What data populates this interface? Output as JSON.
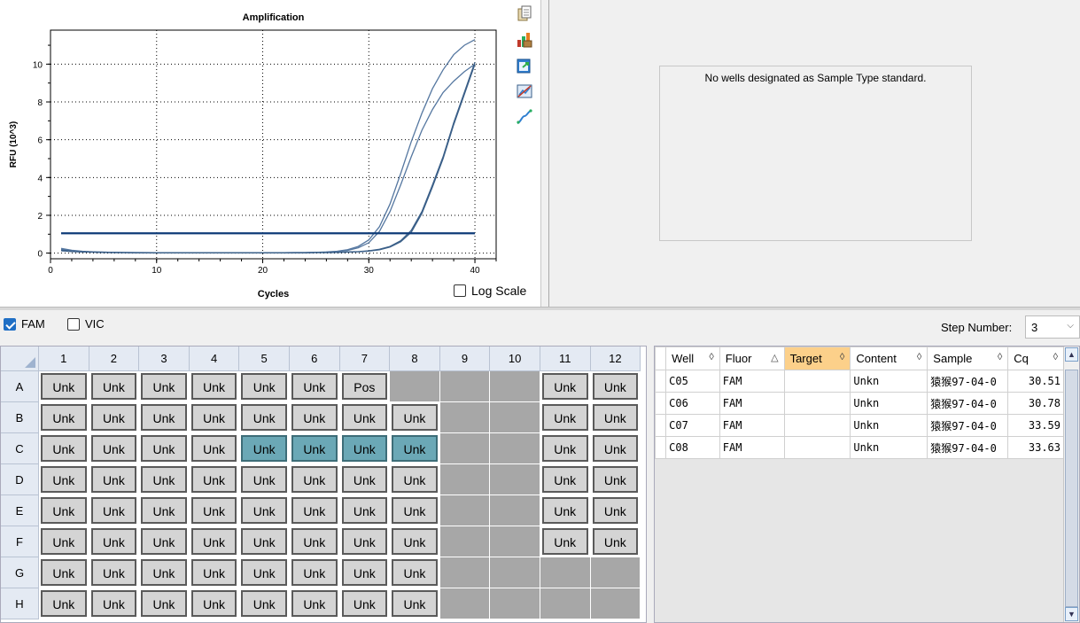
{
  "chart_data": {
    "type": "line",
    "title": "Amplification",
    "xlabel": "Cycles",
    "ylabel": "RFU (10^3)",
    "xlim": [
      0,
      42
    ],
    "ylim": [
      -0.3,
      11.8
    ],
    "xticks": [
      0,
      10,
      20,
      30,
      40
    ],
    "yticks": [
      0,
      2,
      4,
      6,
      8,
      10
    ],
    "grid": "dotted",
    "threshold": 1.05,
    "x": [
      1,
      2,
      3,
      4,
      5,
      6,
      7,
      8,
      9,
      10,
      11,
      12,
      13,
      14,
      15,
      16,
      17,
      18,
      19,
      20,
      21,
      22,
      23,
      24,
      25,
      26,
      27,
      28,
      29,
      30,
      31,
      32,
      33,
      34,
      35,
      36,
      37,
      38,
      39,
      40
    ],
    "series": [
      {
        "values": [
          0.25,
          0.15,
          0.1,
          0.07,
          0.05,
          0.04,
          0.03,
          0.03,
          0.03,
          0.02,
          0.02,
          0.02,
          0.02,
          0.02,
          0.02,
          0.02,
          0.02,
          0.02,
          0.02,
          0.02,
          0.02,
          0.02,
          0.03,
          0.03,
          0.04,
          0.06,
          0.1,
          0.18,
          0.35,
          0.7,
          1.4,
          2.6,
          4.2,
          5.9,
          7.4,
          8.7,
          9.7,
          10.5,
          11.0,
          11.3
        ]
      },
      {
        "values": [
          0.2,
          0.12,
          0.08,
          0.06,
          0.05,
          0.04,
          0.03,
          0.03,
          0.02,
          0.02,
          0.02,
          0.02,
          0.02,
          0.02,
          0.02,
          0.02,
          0.02,
          0.02,
          0.02,
          0.02,
          0.02,
          0.02,
          0.03,
          0.03,
          0.04,
          0.05,
          0.08,
          0.14,
          0.28,
          0.55,
          1.15,
          2.2,
          3.6,
          5.1,
          6.5,
          7.6,
          8.5,
          9.1,
          9.6,
          10.0
        ]
      },
      {
        "values": [
          0.15,
          0.1,
          0.07,
          0.05,
          0.04,
          0.03,
          0.03,
          0.02,
          0.02,
          0.02,
          0.02,
          0.02,
          0.02,
          0.02,
          0.02,
          0.02,
          0.02,
          0.02,
          0.02,
          0.02,
          0.02,
          0.02,
          0.02,
          0.02,
          0.03,
          0.03,
          0.04,
          0.06,
          0.08,
          0.12,
          0.2,
          0.35,
          0.65,
          1.2,
          2.2,
          3.6,
          5.1,
          6.9,
          8.5,
          10.1
        ]
      },
      {
        "values": [
          0.12,
          0.08,
          0.06,
          0.05,
          0.04,
          0.03,
          0.03,
          0.02,
          0.02,
          0.02,
          0.02,
          0.02,
          0.02,
          0.02,
          0.02,
          0.02,
          0.02,
          0.02,
          0.02,
          0.02,
          0.02,
          0.02,
          0.02,
          0.02,
          0.03,
          0.03,
          0.04,
          0.05,
          0.07,
          0.11,
          0.18,
          0.32,
          0.6,
          1.1,
          2.1,
          3.5,
          5.0,
          6.8,
          8.4,
          10.0
        ]
      }
    ]
  },
  "chart_colors": {
    "curve": "#5577a0",
    "curve_dark": "#3a5f88",
    "threshold": "#0f3c78"
  },
  "chart_toolbar": {
    "icons": [
      "copy-icon",
      "export-chart-icon",
      "export-data-icon",
      "chart-settings-icon",
      "curve-icon"
    ]
  },
  "log_scale": {
    "label": "Log Scale",
    "checked": false
  },
  "standard_curve": {
    "message": "No wells designated as Sample Type standard."
  },
  "fluors": [
    {
      "label": "FAM",
      "checked": true
    },
    {
      "label": "VIC",
      "checked": false
    }
  ],
  "step": {
    "label": "Step Number:",
    "value": "3"
  },
  "plate": {
    "columns": [
      "1",
      "2",
      "3",
      "4",
      "5",
      "6",
      "7",
      "8",
      "9",
      "10",
      "11",
      "12"
    ],
    "rows": [
      {
        "label": "A",
        "wells": [
          "Unk",
          "Unk",
          "Unk",
          "Unk",
          "Unk",
          "Unk",
          "Pos",
          "",
          "",
          "",
          "Unk",
          "Unk"
        ]
      },
      {
        "label": "B",
        "wells": [
          "Unk",
          "Unk",
          "Unk",
          "Unk",
          "Unk",
          "Unk",
          "Unk",
          "Unk",
          "",
          "",
          "Unk",
          "Unk"
        ]
      },
      {
        "label": "C",
        "wells": [
          "Unk",
          "Unk",
          "Unk",
          "Unk",
          "Unk",
          "Unk",
          "Unk",
          "Unk",
          "",
          "",
          "Unk",
          "Unk"
        ]
      },
      {
        "label": "D",
        "wells": [
          "Unk",
          "Unk",
          "Unk",
          "Unk",
          "Unk",
          "Unk",
          "Unk",
          "Unk",
          "",
          "",
          "Unk",
          "Unk"
        ]
      },
      {
        "label": "E",
        "wells": [
          "Unk",
          "Unk",
          "Unk",
          "Unk",
          "Unk",
          "Unk",
          "Unk",
          "Unk",
          "",
          "",
          "Unk",
          "Unk"
        ]
      },
      {
        "label": "F",
        "wells": [
          "Unk",
          "Unk",
          "Unk",
          "Unk",
          "Unk",
          "Unk",
          "Unk",
          "Unk",
          "",
          "",
          "Unk",
          "Unk"
        ]
      },
      {
        "label": "G",
        "wells": [
          "Unk",
          "Unk",
          "Unk",
          "Unk",
          "Unk",
          "Unk",
          "Unk",
          "Unk",
          "",
          "",
          "",
          ""
        ]
      },
      {
        "label": "H",
        "wells": [
          "Unk",
          "Unk",
          "Unk",
          "Unk",
          "Unk",
          "Unk",
          "Unk",
          "Unk",
          "",
          "",
          "",
          ""
        ]
      }
    ],
    "selected": [
      "C5",
      "C6",
      "C7",
      "C8"
    ]
  },
  "results": {
    "headers": [
      {
        "label": "Well",
        "sort": "◊"
      },
      {
        "label": "Fluor",
        "sort": "△"
      },
      {
        "label": "Target",
        "sort": "◊",
        "highlight": true
      },
      {
        "label": "Content",
        "sort": "◊"
      },
      {
        "label": "Sample",
        "sort": "◊"
      },
      {
        "label": "Cq",
        "sort": "◊"
      }
    ],
    "rows": [
      {
        "well": "C05",
        "fluor": "FAM",
        "target": "",
        "content": "Unkn",
        "sample": "猿猴97-04-0",
        "cq": "30.51"
      },
      {
        "well": "C06",
        "fluor": "FAM",
        "target": "",
        "content": "Unkn",
        "sample": "猿猴97-04-0",
        "cq": "30.78"
      },
      {
        "well": "C07",
        "fluor": "FAM",
        "target": "",
        "content": "Unkn",
        "sample": "猿猴97-04-0",
        "cq": "33.59"
      },
      {
        "well": "C08",
        "fluor": "FAM",
        "target": "",
        "content": "Unkn",
        "sample": "猿猴97-04-0",
        "cq": "33.63"
      }
    ]
  }
}
